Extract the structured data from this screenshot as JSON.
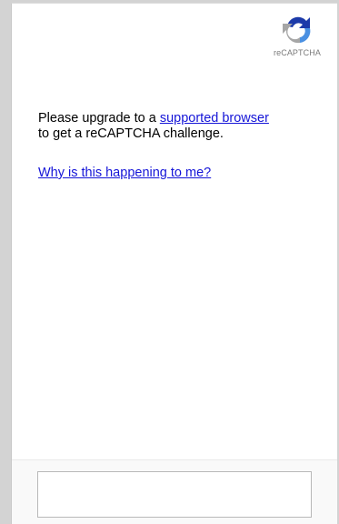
{
  "logo": {
    "icon": "recaptcha-logo-icon",
    "label": "reCAPTCHA"
  },
  "message": {
    "prefix": "Please upgrade to a ",
    "link": "supported browser",
    "suffix": "to get a reCAPTCHA challenge."
  },
  "why_link": "Why is this happening to me?",
  "colors": {
    "link": "#1515d8",
    "logo_blue": "#4a90e2",
    "logo_dark_blue": "#1c3aa9",
    "logo_grey": "#a6a6a6"
  }
}
